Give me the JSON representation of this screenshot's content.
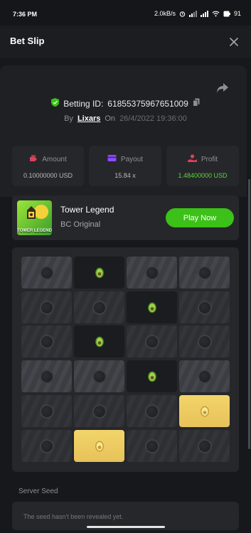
{
  "status_bar": {
    "time": "7:36 PM",
    "network_speed": "2.0kB/s",
    "battery": "91"
  },
  "header": {
    "title": "Bet Slip",
    "close_icon": "close-icon"
  },
  "bet": {
    "id_label": "Betting ID:",
    "id": "61855375967651009",
    "by_label": "By",
    "user": "Lixars",
    "on_label": "On",
    "date": "26/4/2022 19:36:00"
  },
  "stats": [
    {
      "label": "Amount",
      "value": "0.10000000 USD",
      "icon": "amount-icon",
      "color": "#e0405a"
    },
    {
      "label": "Payout",
      "value": "15.84 x",
      "icon": "payout-icon",
      "color": "#8f4bff"
    },
    {
      "label": "Profit",
      "value": "1.48400000 USD",
      "icon": "profit-icon",
      "color": "#e0405a",
      "value_color": "#5fd536"
    }
  ],
  "game": {
    "name": "Tower Legend",
    "provider": "BC Original",
    "thumb_text": "TOWER LEGEND",
    "play_label": "Play Now"
  },
  "board": {
    "rows": [
      [
        "lit",
        "open-avocado",
        "lit",
        "lit"
      ],
      [
        "dim",
        "dim",
        "open-avocado",
        "dim"
      ],
      [
        "dim",
        "open-avocado",
        "dim",
        "dim"
      ],
      [
        "lit",
        "lit",
        "open-avocado",
        "lit"
      ],
      [
        "dim",
        "dim",
        "dim",
        "gold"
      ],
      [
        "dim",
        "gold",
        "dim",
        "dim"
      ]
    ]
  },
  "server_seed": {
    "label": "Server Seed",
    "text": "The seed hasn't been revealed yet."
  },
  "colors": {
    "accent_green": "#3bc117",
    "gold_tile": "#ecc85f",
    "avocado": "#7cc52f"
  }
}
